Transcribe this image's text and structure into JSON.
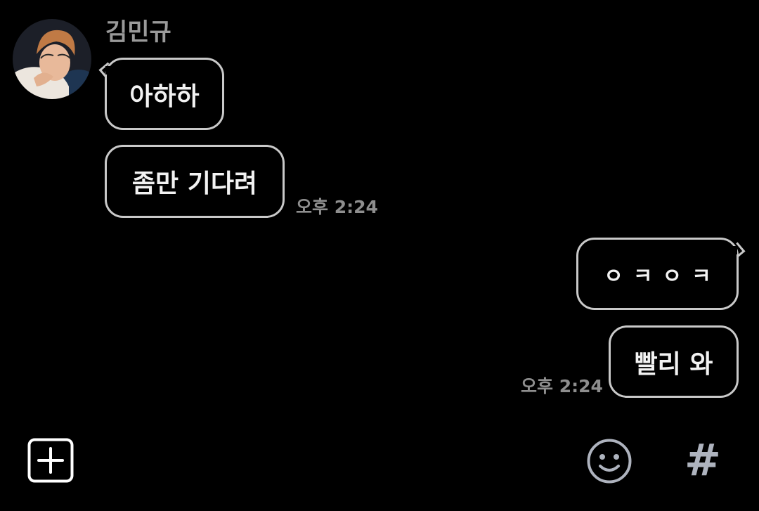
{
  "incoming": {
    "sender_name": "김민규",
    "messages": [
      "아하하",
      "좀만 기다려"
    ],
    "time": "오후 2:24"
  },
  "outgoing": {
    "messages": [
      "ㅇㅋㅇㅋ",
      "빨리 와"
    ],
    "time": "오후 2:24"
  },
  "input_bar": {
    "attach_icon": "plus-square-icon",
    "emoji_icon": "smiley-icon",
    "hashtag_icon": "hashtag-icon",
    "hashtag_glyph": "#"
  },
  "colors": {
    "background": "#000000",
    "bubble_border": "#c9c9c9",
    "bubble_text": "#f2f2f2",
    "meta_text": "#8e8e8e"
  }
}
